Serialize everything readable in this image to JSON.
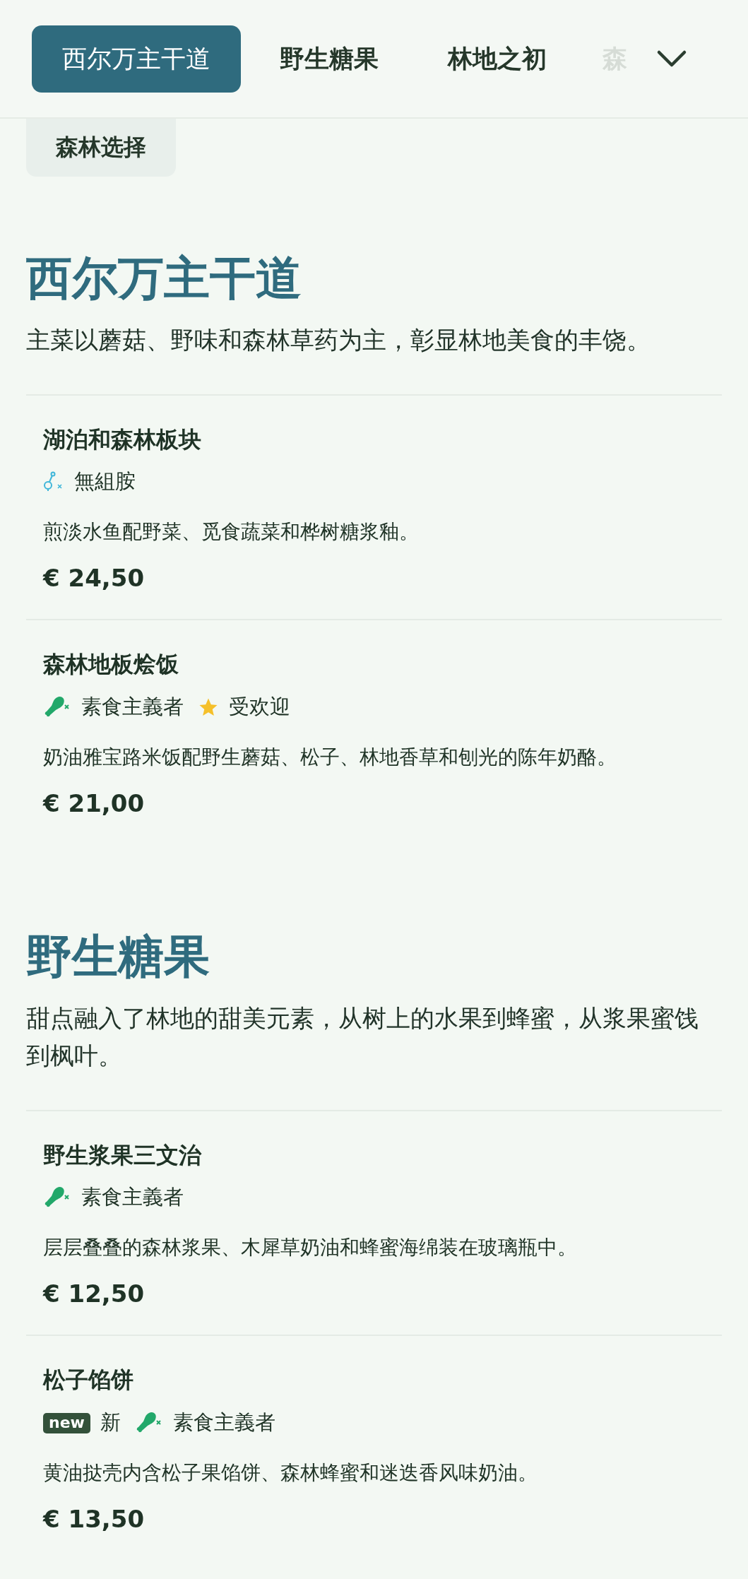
{
  "tabs": [
    {
      "label": "西尔万主干道",
      "selected": true
    },
    {
      "label": "野生糖果",
      "selected": false
    },
    {
      "label": "林地之初",
      "selected": false
    },
    {
      "label": "森",
      "selected": false,
      "faded": true
    }
  ],
  "more_tab": {
    "label": "森林选择",
    "selected": false
  },
  "sections": [
    {
      "title": "西尔万主干道",
      "description": "主菜以蘑菇、野味和森林草药为主，彰显林地美食的丰饶。",
      "items": [
        {
          "name": "湖泊和森林板块",
          "tags": [
            {
              "kind": "allergen",
              "label": "無組胺"
            }
          ],
          "description": "煎淡水鱼配野菜、觅食蔬菜和桦树糖浆釉。",
          "price": "€ 24,50"
        },
        {
          "name": "森林地板烩饭",
          "tags": [
            {
              "kind": "vegetarian",
              "label": "素食主義者"
            },
            {
              "kind": "popular",
              "label": "受欢迎"
            }
          ],
          "description": "奶油雅宝路米饭配野生蘑菇、松子、林地香草和刨光的陈年奶酪。",
          "price": "€ 21,00"
        }
      ]
    },
    {
      "title": "野生糖果",
      "description": "甜点融入了林地的甜美元素，从树上的水果到蜂蜜，从浆果蜜饯到枫叶。",
      "items": [
        {
          "name": "野生浆果三文治",
          "tags": [
            {
              "kind": "vegetarian",
              "label": "素食主義者"
            }
          ],
          "description": "层层叠叠的森林浆果、木犀草奶油和蜂蜜海绵装在玻璃瓶中。",
          "price": "€ 12,50"
        },
        {
          "name": "松子馅饼",
          "tags": [
            {
              "kind": "new",
              "badge": "new",
              "label": "新"
            },
            {
              "kind": "vegetarian",
              "label": "素食主義者"
            }
          ],
          "description": "黄油挞壳内含松子果馅饼、森林蜂蜜和迷迭香风味奶油。",
          "price": "€ 13,50"
        }
      ]
    }
  ]
}
